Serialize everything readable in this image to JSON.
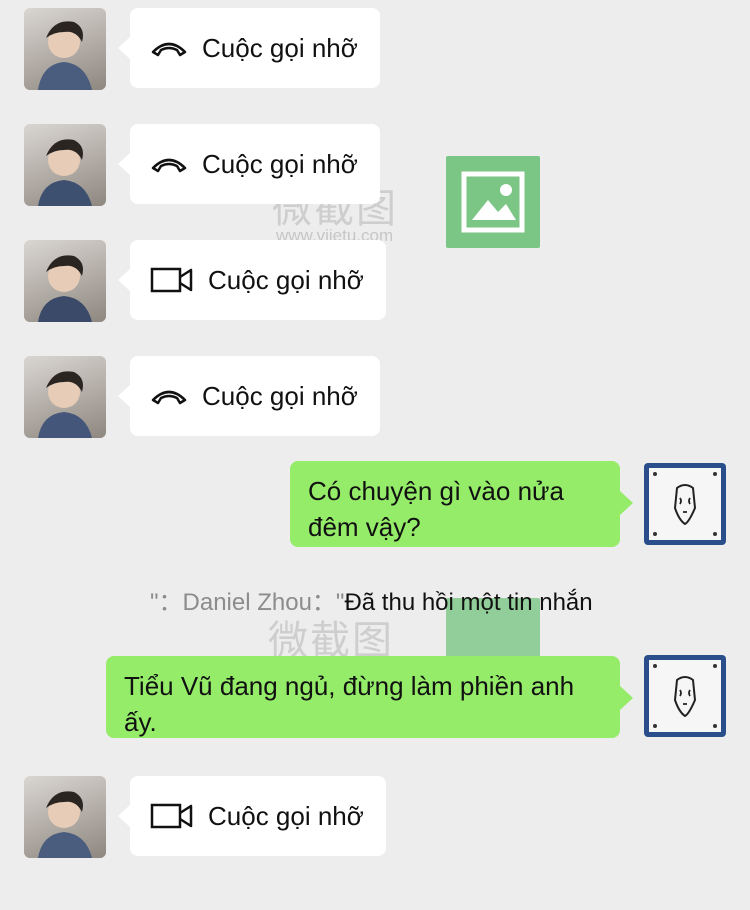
{
  "messages": [
    {
      "type": "incoming",
      "call_type": "voice",
      "icon": "phone-hangup-icon",
      "text": "Cuộc gọi nhỡ"
    },
    {
      "type": "incoming",
      "call_type": "voice",
      "icon": "phone-hangup-icon",
      "text": "Cuộc gọi nhỡ"
    },
    {
      "type": "incoming",
      "call_type": "video",
      "icon": "video-camera-icon",
      "text": "Cuộc gọi nhỡ"
    },
    {
      "type": "incoming",
      "call_type": "voice",
      "icon": "phone-hangup-icon",
      "text": "Cuộc gọi nhỡ"
    },
    {
      "type": "outgoing",
      "text": "Có chuyện gì vào nửa đêm vậy?"
    },
    {
      "type": "system",
      "prefix": "\"：Daniel Zhou：\"",
      "text": "Đã thu hồi một tin nhắn"
    },
    {
      "type": "outgoing",
      "text": "Tiểu Vũ đang ngủ, đừng làm phiền anh ấy."
    },
    {
      "type": "incoming",
      "call_type": "video",
      "icon": "video-camera-icon",
      "text": "Cuộc gọi nhỡ"
    }
  ],
  "watermark": {
    "text": "微截图",
    "url": "www.vjietu.com"
  },
  "colors": {
    "background": "#ededed",
    "outgoing_bubble": "#95ec69",
    "incoming_bubble": "#ffffff",
    "self_avatar_frame": "#2a4e8c"
  }
}
